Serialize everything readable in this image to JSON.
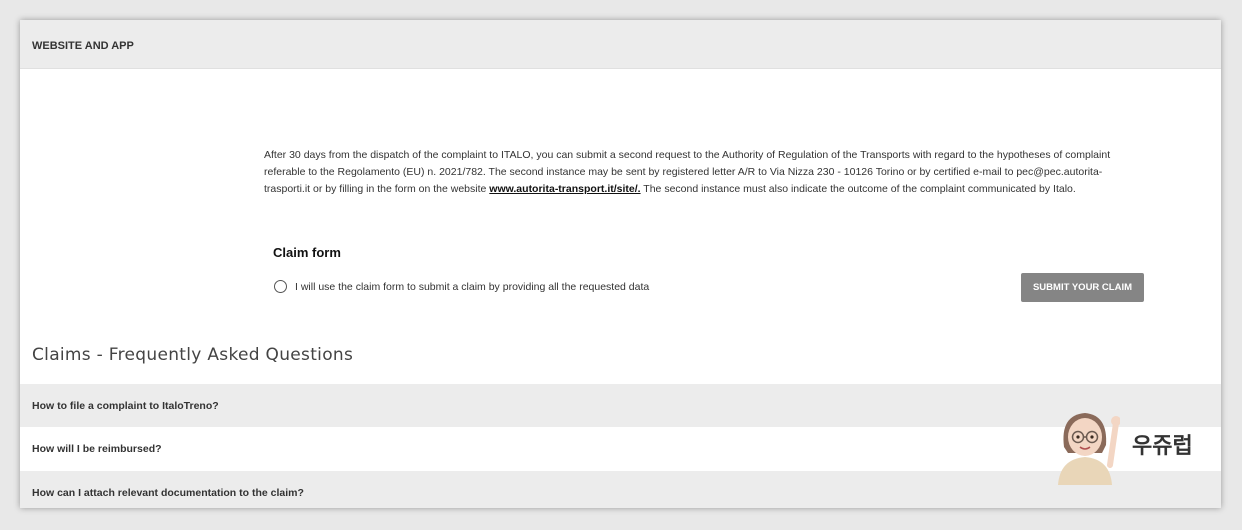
{
  "section": {
    "title": "WEBSITE AND APP"
  },
  "info": {
    "text_before_link": "After 30 days from the dispatch of the complaint to ITALO, you can submit a second request to the Authority of Regulation of the Transports with regard to the hypotheses of complaint referable to the Regolamento (EU) n. 2021/782. The second instance may be sent by registered letter A/R to Via Nizza 230 - 10126 Torino or by certified e-mail to pec@pec.autorita-trasporti.it or by filling in the form on the website ",
    "link": "www.autorita-transport.it/site/.",
    "text_after_link": " The second instance must also indicate the outcome of the complaint communicated by Italo."
  },
  "claim": {
    "title": "Claim form",
    "radio_label": "I will use the claim form to submit a claim by providing all the requested data",
    "submit_label": "SUBMIT YOUR CLAIM"
  },
  "faq": {
    "title": "Claims - Frequently Asked Questions",
    "items": [
      "How to file a complaint to ItaloTreno?",
      "How will I be reimbursed?",
      "How can I attach relevant documentation to the claim?"
    ]
  },
  "watermark": {
    "text": "우쥬럽",
    "icon": "waving-woman-avatar-icon"
  },
  "colors": {
    "button": "#858585",
    "row_gray": "#ececec"
  }
}
